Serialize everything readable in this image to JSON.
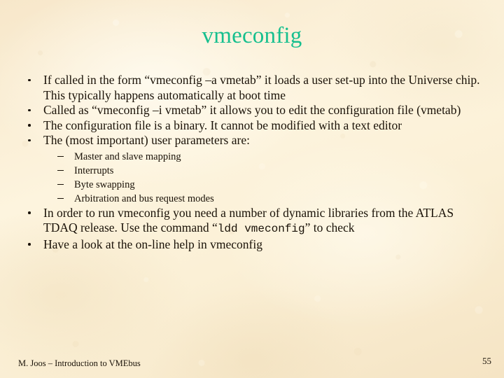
{
  "slide": {
    "title": "vmeconfig",
    "title_color": "#16bf8e",
    "background_color": "#faeed3",
    "text_color": "#1a1208"
  },
  "bullets": [
    {
      "level": 1,
      "text": "If called in the form “vmeconfig –a vmetab” it loads a user set-up into the Universe chip. This typically happens automatically at boot time"
    },
    {
      "level": 1,
      "text": "Called as “vmeconfig –i vmetab” it allows you to edit the configuration file (vmetab)"
    },
    {
      "level": 1,
      "text": "The configuration file is a binary. It cannot be modified with a text editor"
    },
    {
      "level": 1,
      "text": "The (most important) user parameters are:"
    },
    {
      "level": 2,
      "text": "Master and slave mapping"
    },
    {
      "level": 2,
      "text": "Interrupts"
    },
    {
      "level": 2,
      "text": "Byte swapping"
    },
    {
      "level": 2,
      "text": "Arbitration and bus request modes"
    },
    {
      "level": 1,
      "segments": [
        {
          "style": "normal",
          "text": "In order to run vmeconfig you need a number of dynamic libraries from the ATLAS TDAQ release. Use the command “"
        },
        {
          "style": "mono",
          "text": "ldd vmeconfig"
        },
        {
          "style": "normal",
          "text": "” to check"
        }
      ],
      "text": "In order to run vmeconfig you need a number of dynamic libraries from the ATLAS TDAQ release. Use the command “ldd vmeconfig” to check"
    },
    {
      "level": 1,
      "text": "Have a look at the on-line help in vmeconfig"
    }
  ],
  "footer": {
    "attribution": "M. Joos – Introduction to VMEbus",
    "page_number": "55"
  }
}
